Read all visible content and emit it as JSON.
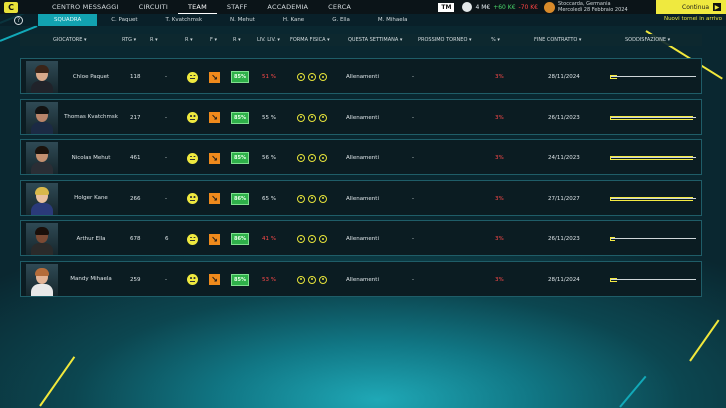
{
  "topbar": {
    "menu_label": "C",
    "nav": [
      "CENTRO MESSAGGI",
      "CIRCUITI",
      "TEAM",
      "STAFF",
      "ACCADEMIA",
      "CERCA"
    ],
    "active_nav": 2,
    "tag": "TM",
    "money_amount": "4 M€",
    "money_up": "+60 K€",
    "money_down": "-70 K€",
    "date_line1": "Stoccarda, Germania",
    "date_line2": "Mercoledì 28 Febbraio 2024",
    "continue_label": "Continua"
  },
  "subbar": {
    "help": "?",
    "tabs": [
      "SQUADRA",
      "C. Paquet",
      "T. Kvatchmsk",
      "N. Mehut",
      "H. Kane",
      "G. Ella",
      "M. Mihaela"
    ],
    "news": "Nuovi tornei in arrivo"
  },
  "columns": [
    "GIOCATORE",
    "RTG",
    "R",
    "R",
    "F",
    "R",
    "LIV. LIV.",
    "FORMA FISICA",
    "QUESTA SETTIMANA",
    "PROSSIMO TORNEO",
    "%",
    "FINE CONTRATTO",
    "SODDISFAZIONE"
  ],
  "players": [
    {
      "name": "Chloe Paquet",
      "rank": "118",
      "dash": "-",
      "badge": "85%",
      "pct": "51 %",
      "activity": "Allenamenti",
      "next": "-",
      "cut": "3%",
      "contract": "28/11/2024",
      "satisfaction": 0.08,
      "skin": "#d9a98a",
      "hair": "#3a2418",
      "shirt": "#20232a",
      "pct_red": true
    },
    {
      "name": "Thomas Kvatchmsk",
      "rank": "217",
      "dash": "-",
      "badge": "85%",
      "pct": "55 %",
      "activity": "Allenamenti",
      "next": "-",
      "cut": "3%",
      "contract": "26/11/2023",
      "satisfaction": 0.96,
      "skin": "#b9846a",
      "hair": "#121212",
      "shirt": "#1b2a44",
      "pct_red": false
    },
    {
      "name": "Nicolas Mehut",
      "rank": "461",
      "dash": "-",
      "badge": "85%",
      "pct": "56 %",
      "activity": "Allenamenti",
      "next": "-",
      "cut": "3%",
      "contract": "24/11/2023",
      "satisfaction": 0.96,
      "skin": "#c49070",
      "hair": "#1a120c",
      "shirt": "#2a2e35",
      "pct_red": false
    },
    {
      "name": "Holger Kane",
      "rank": "266",
      "dash": "-",
      "badge": "86%",
      "pct": "65 %",
      "activity": "Allenamenti",
      "next": "-",
      "cut": "3%",
      "contract": "27/11/2027",
      "satisfaction": 0.96,
      "skin": "#e8c0a0",
      "hair": "#d8b84a",
      "shirt": "#2a3a7a",
      "pct_red": false
    },
    {
      "name": "Arthur Ella",
      "rank": "678",
      "dash": "6",
      "badge": "86%",
      "pct": "41 %",
      "activity": "Allenamenti",
      "next": "-",
      "cut": "3%",
      "contract": "26/11/2023",
      "satisfaction": 0.06,
      "skin": "#7b4a34",
      "hair": "#1a0f0a",
      "shirt": "#2a2a2a",
      "pct_red": true
    },
    {
      "name": "Mandy Mihaela",
      "rank": "259",
      "dash": "-",
      "badge": "85%",
      "pct": "53 %",
      "activity": "Allenamenti",
      "next": "-",
      "cut": "3%",
      "contract": "28/11/2024",
      "satisfaction": 0.08,
      "skin": "#e3b496",
      "hair": "#b46c3a",
      "shirt": "#e8e8e8",
      "pct_red": true
    }
  ]
}
